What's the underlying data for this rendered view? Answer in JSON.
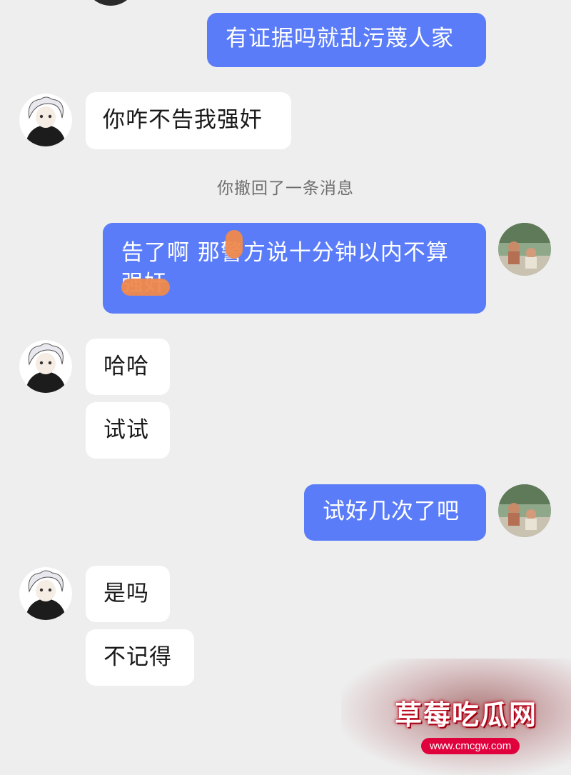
{
  "messages": [
    {
      "text": "有证据吗就乱污蔑人家"
    },
    {
      "text": "你咋不告我强奸"
    },
    {
      "text": "告了啊 那警方说十分钟以内不算强奸"
    },
    {
      "text": "哈哈"
    },
    {
      "text": "试试"
    },
    {
      "text": "试好几次了吧"
    },
    {
      "text": "是吗"
    },
    {
      "text": "不记得"
    }
  ],
  "system_notice": "你撤回了一条消息",
  "watermark": {
    "title": "草莓吃瓜网",
    "url": "www.cmcgw.com"
  },
  "colors": {
    "outgoing_bubble": "#5a7cf8",
    "incoming_bubble": "#ffffff",
    "background": "#eeeeee",
    "redaction": "#f08a4c"
  },
  "icons": {
    "contact_avatar": "anime-character-avatar",
    "self_avatar": "fishing-photo-avatar"
  }
}
